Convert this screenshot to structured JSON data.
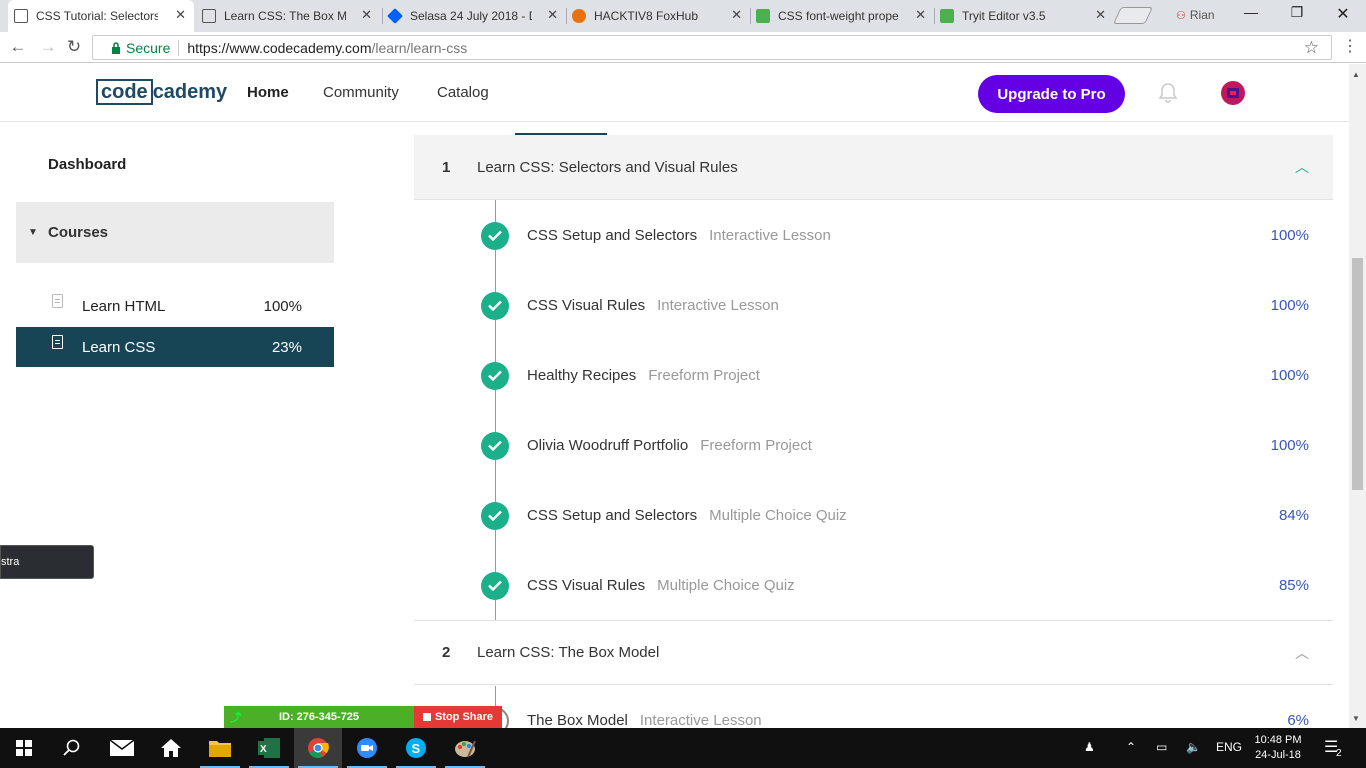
{
  "browser": {
    "tabs": [
      {
        "title": "CSS Tutorial: Selectors,",
        "active": true,
        "favicon_color": "#555555"
      },
      {
        "title": "Learn CSS: The Box Mo",
        "active": false,
        "favicon_color": "#555555"
      },
      {
        "title": "Selasa 24 July 2018 - D",
        "active": false,
        "favicon_color": "#0061fe"
      },
      {
        "title": "HACKTIV8 FoxHub",
        "active": false,
        "favicon_color": "#e8710a"
      },
      {
        "title": "CSS font-weight prope",
        "active": false,
        "favicon_color": "#4caf50"
      },
      {
        "title": "Tryit Editor v3.5",
        "active": false,
        "favicon_color": "#4caf50"
      }
    ],
    "close_glyph": "✕",
    "profile_name": "Rian",
    "secure_label": "Secure",
    "url_host": "https://www.codecademy.com",
    "url_path": "/learn/learn-css"
  },
  "site": {
    "logo_boxed": "code",
    "logo_rest": "cademy",
    "nav": [
      {
        "label": "Home",
        "active": true
      },
      {
        "label": "Community",
        "active": false
      },
      {
        "label": "Catalog",
        "active": false
      }
    ],
    "upgrade_label": "Upgrade to Pro",
    "brand_color": "#6400e4"
  },
  "sidebar": {
    "dashboard_label": "Dashboard",
    "courses_label": "Courses",
    "courses": [
      {
        "name": "Learn HTML",
        "percent": "100%",
        "active": false
      },
      {
        "name": "Learn CSS",
        "percent": "23%",
        "active": true
      }
    ]
  },
  "units": [
    {
      "number": "1",
      "title": "Learn CSS: Selectors and Visual Rules",
      "expanded": true,
      "lessons": [
        {
          "title": "CSS Setup and Selectors",
          "type": "Interactive Lesson",
          "percent": "100%",
          "done": true
        },
        {
          "title": "CSS Visual Rules",
          "type": "Interactive Lesson",
          "percent": "100%",
          "done": true
        },
        {
          "title": "Healthy Recipes",
          "type": "Freeform Project",
          "percent": "100%",
          "done": true
        },
        {
          "title": "Olivia Woodruff Portfolio",
          "type": "Freeform Project",
          "percent": "100%",
          "done": true
        },
        {
          "title": "CSS Setup and Selectors",
          "type": "Multiple Choice Quiz",
          "percent": "84%",
          "done": true
        },
        {
          "title": "CSS Visual Rules",
          "type": "Multiple Choice Quiz",
          "percent": "85%",
          "done": true
        }
      ]
    },
    {
      "number": "2",
      "title": "Learn CSS: The Box Model",
      "expanded": true,
      "lessons": [
        {
          "title": "The Box Model",
          "type": "Interactive Lesson",
          "percent": "6%",
          "done": false
        }
      ]
    }
  ],
  "overlays": {
    "tooltip_text": "stra",
    "share_id": "ID: 276-345-725",
    "stop_share_label": "Stop Share"
  },
  "taskbar": {
    "language": "ENG",
    "time": "10:48 PM",
    "date": "24-Jul-18",
    "notification_count": "2"
  }
}
